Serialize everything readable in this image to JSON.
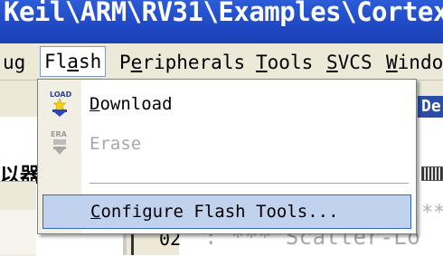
{
  "window": {
    "title": "Keil\\ARM\\RV31\\Examples\\Cortex"
  },
  "menubar": {
    "items": [
      {
        "label": "ug"
      },
      {
        "label": "Flash",
        "active": true
      },
      {
        "label": "Peripherals"
      },
      {
        "label": "Tools"
      },
      {
        "label": "SVCS"
      },
      {
        "label": "Windo"
      }
    ]
  },
  "flash_menu": {
    "download": {
      "label": "Download",
      "icon": "download-icon",
      "icon_text": "LOAD",
      "enabled": true
    },
    "erase": {
      "label": "Erase",
      "icon": "erase-icon",
      "icon_text": "ERA",
      "enabled": false
    },
    "configure": {
      "label": "Configure Flash Tools...",
      "highlighted": true
    }
  },
  "background": {
    "tab_label": "De",
    "chinese_text": "以器",
    "line_number": "02",
    "code_text": ": *** Scatter-Lo",
    "code_fragment": "**"
  },
  "colors": {
    "titlebar": "#1f48c4",
    "menubar": "#ece9d8",
    "highlight": "#c1d2ee",
    "highlight_border": "#316ac5",
    "disabled_text": "#a7a6aa"
  }
}
